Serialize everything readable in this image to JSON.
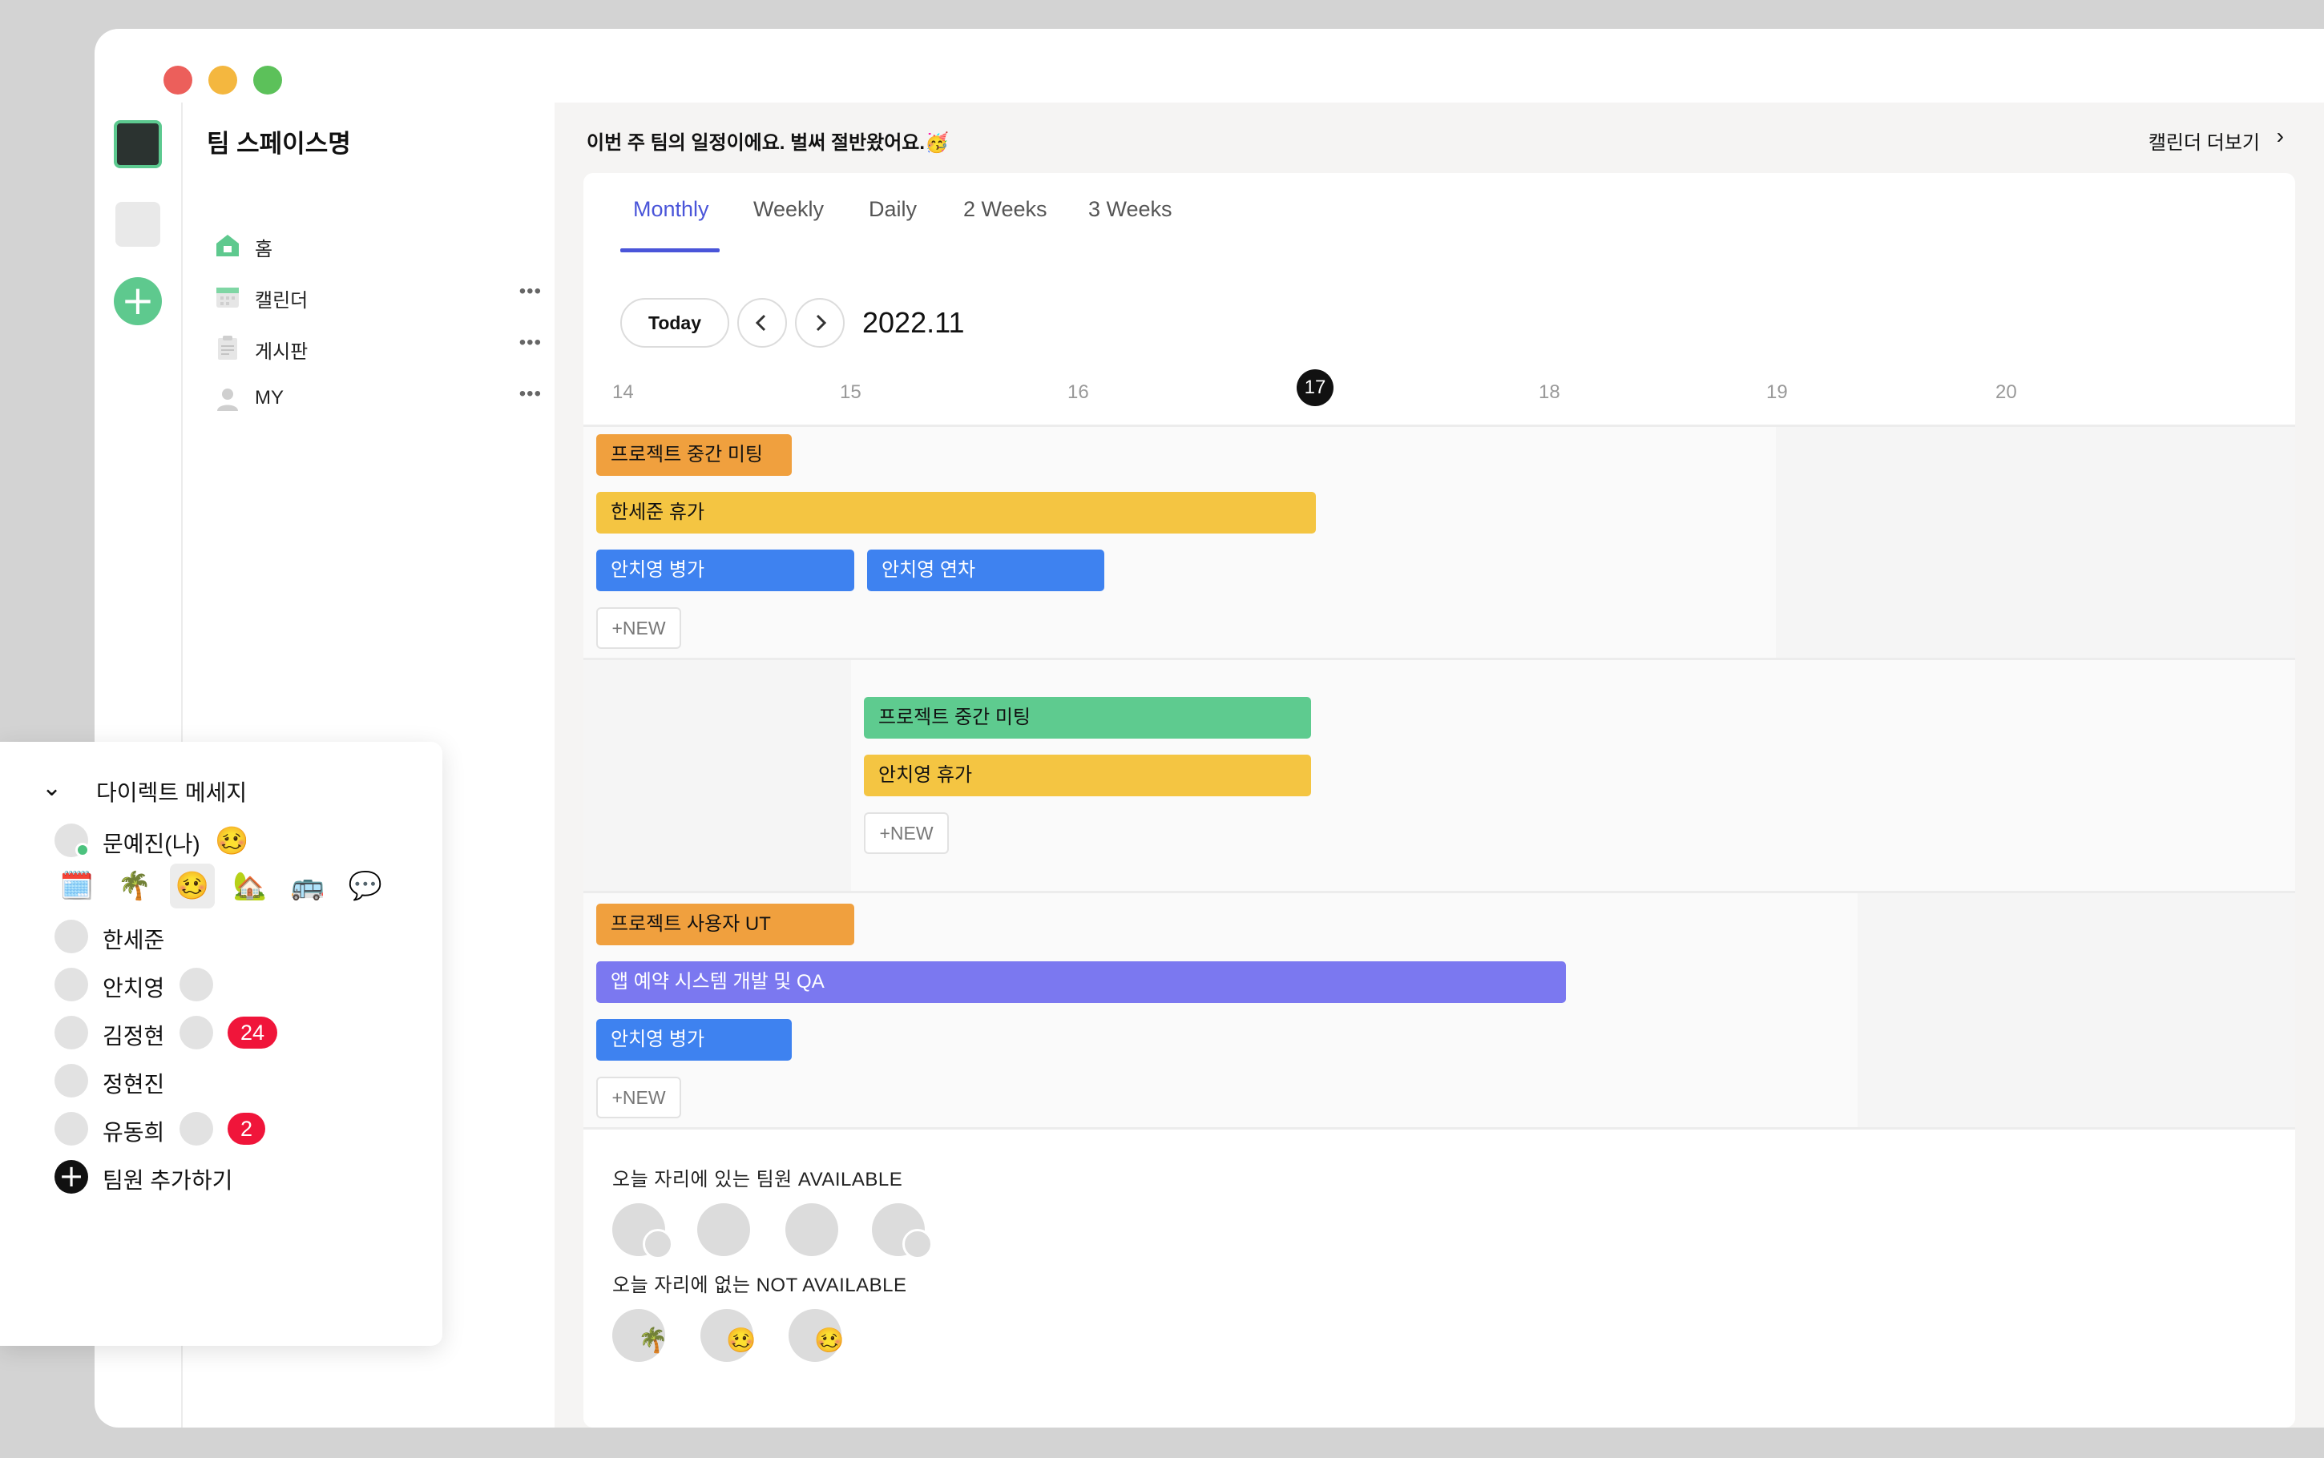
{
  "window": {
    "controls": {
      "close_color": "#ec5f5b",
      "minimize_color": "#f4b73f",
      "maximize_color": "#5cc15a"
    }
  },
  "sidebar": {
    "team_name": "팀 스페이스명",
    "items": [
      {
        "label": "홈",
        "icon": "home-icon"
      },
      {
        "label": "캘린더",
        "icon": "calendar-icon",
        "more": "•••"
      },
      {
        "label": "게시판",
        "icon": "clipboard-icon",
        "more": "•••"
      },
      {
        "label": "MY",
        "icon": "person-icon",
        "more": "•••"
      }
    ]
  },
  "header": {
    "banner": "이번 주 팀의 일정이에요. 벌써 절반왔어요.🥳",
    "more_link": "캘린더 더보기",
    "more_chevron": "›"
  },
  "tabs": [
    "Monthly",
    "Weekly",
    "Daily",
    "2 Weeks",
    "3 Weeks"
  ],
  "active_tab": "Monthly",
  "toolbar": {
    "today": "Today",
    "prev": "‹",
    "next": "›",
    "month": "2022.11"
  },
  "days": [
    "14",
    "15",
    "16",
    "17",
    "18",
    "19",
    "20"
  ],
  "today_day": "17",
  "groups": [
    {
      "events": [
        {
          "label": "프로젝트 중간 미팅",
          "color": "#f0a03e"
        },
        {
          "label": "한세준 휴가",
          "color": "#f4c542"
        },
        {
          "label": "안치영 병가",
          "color": "#3e82f0"
        },
        {
          "label": "안치영 연차",
          "color": "#3e82f0"
        }
      ],
      "new_label": "+NEW"
    },
    {
      "events": [
        {
          "label": "프로젝트 중간 미팅",
          "color": "#5ecb8f"
        },
        {
          "label": "안치영 휴가",
          "color": "#f4c542"
        }
      ],
      "new_label": "+NEW"
    },
    {
      "events": [
        {
          "label": "프로젝트 사용자 UT",
          "color": "#f0a03e"
        },
        {
          "label": "앱 예약 시스템 개발 및 QA",
          "color": "#7b78f0"
        },
        {
          "label": "안치영 병가",
          "color": "#3e82f0"
        }
      ],
      "new_label": "+NEW"
    }
  ],
  "availability": {
    "available_title": "오늘 자리에 있는 팀원 AVAILABLE",
    "not_available_title": "오늘 자리에 없는 NOT AVAILABLE",
    "not_available_emojis": [
      "🌴",
      "🥴",
      "🥴"
    ]
  },
  "dm": {
    "title": "다이렉트 메세지",
    "chevron": "⌄",
    "me": {
      "name": "문예진(나)",
      "emoji": "🥴"
    },
    "emoji_picker": [
      "🗓️",
      "🌴",
      "🥴",
      "🏡",
      "🚌",
      "💬"
    ],
    "members": [
      {
        "name": "한세준"
      },
      {
        "name": "안치영"
      },
      {
        "name": "김정현",
        "badge": "24"
      },
      {
        "name": "정현진"
      },
      {
        "name": "유동희",
        "badge": "2"
      }
    ],
    "add_label": "팀원 추가하기"
  }
}
